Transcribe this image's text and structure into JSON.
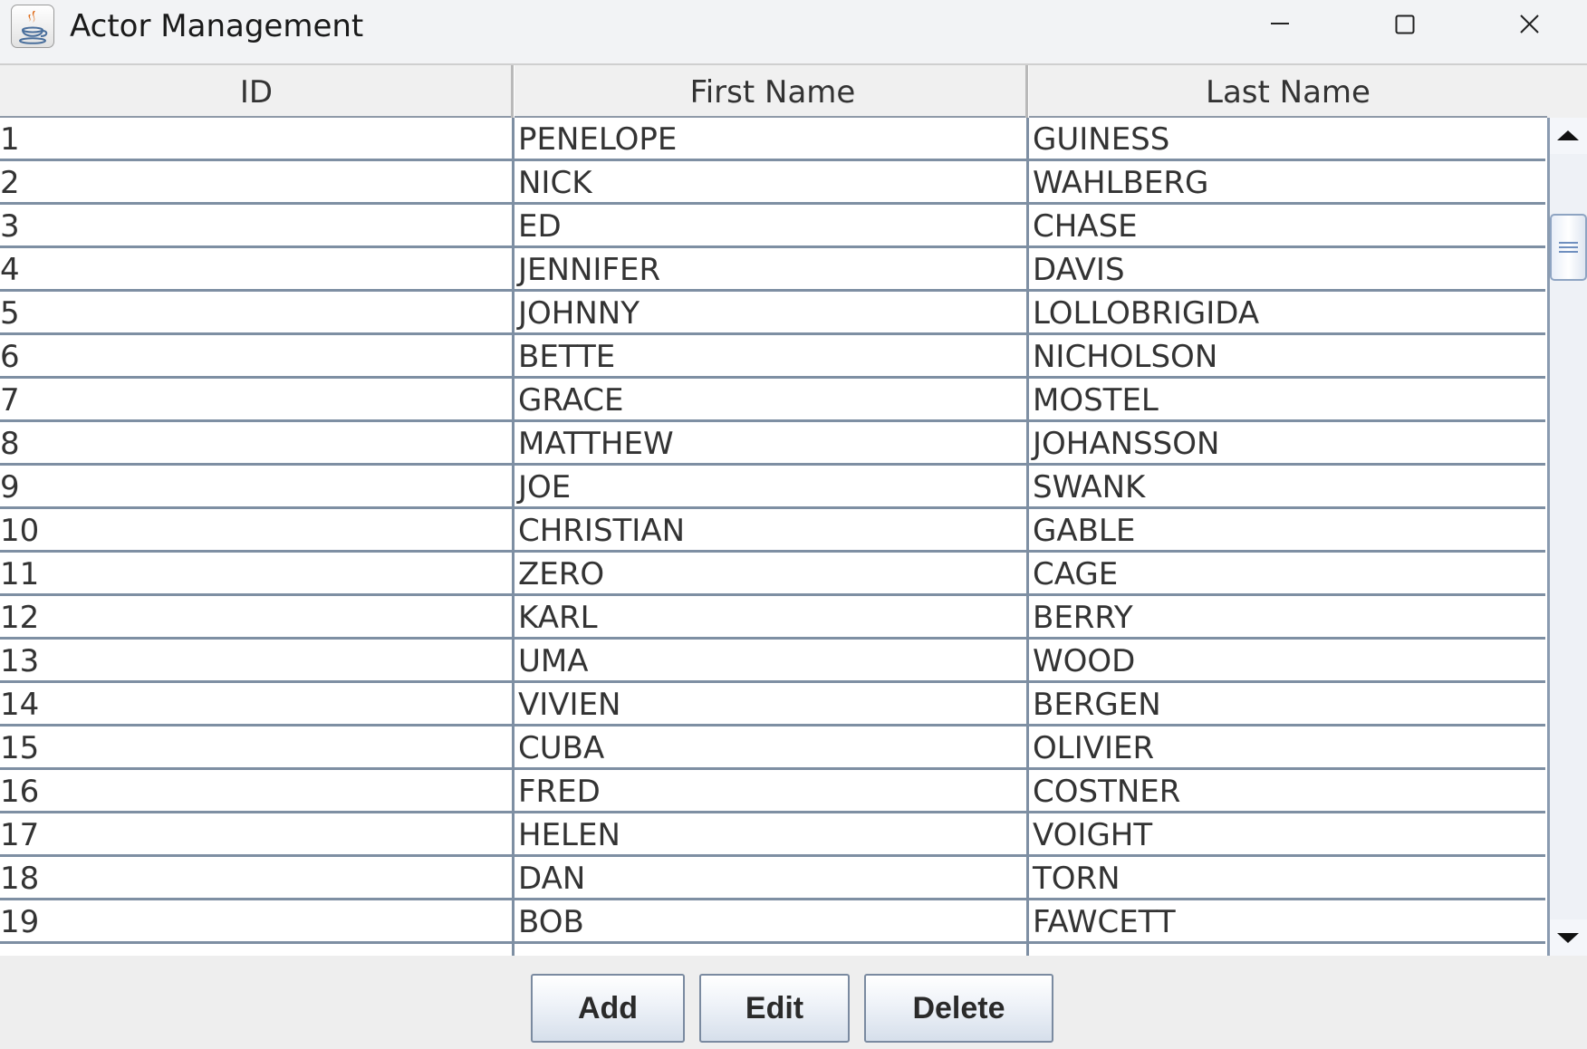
{
  "window": {
    "title": "Actor Management",
    "app_icon": "java-coffee-cup-icon",
    "controls": {
      "minimize": "minimize-icon",
      "maximize": "maximize-icon",
      "close": "close-icon"
    }
  },
  "table": {
    "columns": [
      "ID",
      "First Name",
      "Last Name"
    ],
    "rows": [
      {
        "id": "1",
        "first": "PENELOPE",
        "last": "GUINESS"
      },
      {
        "id": "2",
        "first": "NICK",
        "last": "WAHLBERG"
      },
      {
        "id": "3",
        "first": "ED",
        "last": "CHASE"
      },
      {
        "id": "4",
        "first": "JENNIFER",
        "last": "DAVIS"
      },
      {
        "id": "5",
        "first": "JOHNNY",
        "last": "LOLLOBRIGIDA"
      },
      {
        "id": "6",
        "first": "BETTE",
        "last": "NICHOLSON"
      },
      {
        "id": "7",
        "first": "GRACE",
        "last": "MOSTEL"
      },
      {
        "id": "8",
        "first": "MATTHEW",
        "last": "JOHANSSON"
      },
      {
        "id": "9",
        "first": "JOE",
        "last": "SWANK"
      },
      {
        "id": "10",
        "first": "CHRISTIAN",
        "last": "GABLE"
      },
      {
        "id": "11",
        "first": "ZERO",
        "last": "CAGE"
      },
      {
        "id": "12",
        "first": "KARL",
        "last": "BERRY"
      },
      {
        "id": "13",
        "first": "UMA",
        "last": "WOOD"
      },
      {
        "id": "14",
        "first": "VIVIEN",
        "last": "BERGEN"
      },
      {
        "id": "15",
        "first": "CUBA",
        "last": "OLIVIER"
      },
      {
        "id": "16",
        "first": "FRED",
        "last": "COSTNER"
      },
      {
        "id": "17",
        "first": "HELEN",
        "last": "VOIGHT"
      },
      {
        "id": "18",
        "first": "DAN",
        "last": "TORN"
      },
      {
        "id": "19",
        "first": "BOB",
        "last": "FAWCETT"
      }
    ]
  },
  "scrollbar": {
    "up_icon": "arrow-up-icon",
    "down_icon": "arrow-down-icon",
    "thumb_icon": "grip-lines-icon"
  },
  "buttons": {
    "add": "Add",
    "edit": "Edit",
    "delete": "Delete"
  },
  "colors": {
    "grid_line": "#7e8fa3",
    "header_bg": "#f0f0f0",
    "button_border": "#7a8aa0",
    "icon_orange": "#e06e1d",
    "icon_blue": "#4a6f9c"
  }
}
